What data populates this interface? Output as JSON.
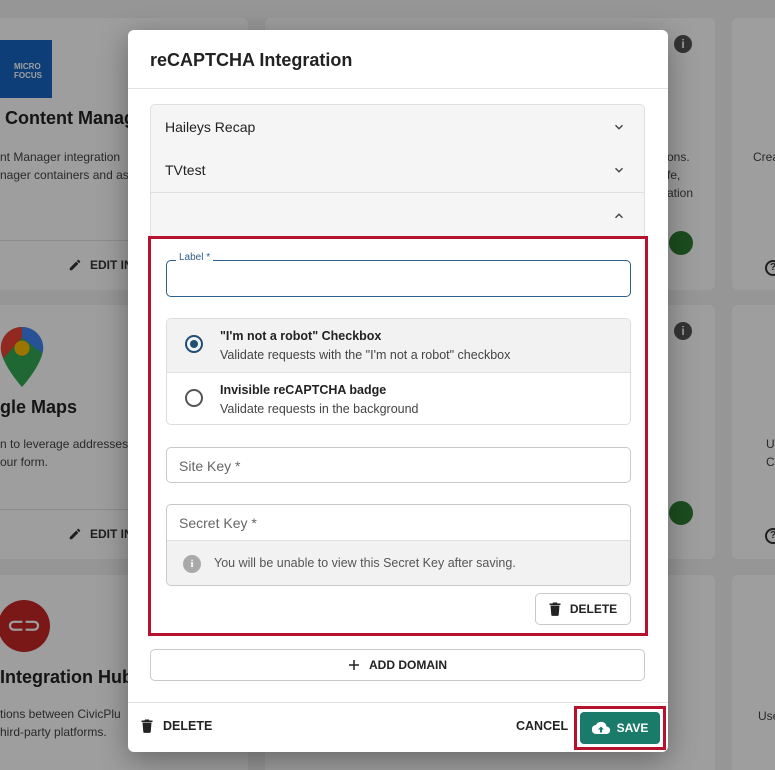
{
  "background": {
    "cards": [
      {
        "title": "Content Manag",
        "lines": [
          "nt Manager integration",
          "nager containers and as"
        ],
        "edit_label": "EDIT IN"
      },
      {
        "title": "gle Maps",
        "lines": [
          "n to leverage addresses",
          "our form."
        ],
        "edit_label": "EDIT IN"
      },
      {
        "title": "Integration Hub",
        "lines": [
          "tions between CivicPlu",
          "hird-party platforms."
        ]
      }
    ],
    "middle_right_lines": [
      "ons.",
      "fe,",
      "ation"
    ],
    "far_right_texts": [
      "Crea",
      "U",
      "C",
      "Use"
    ],
    "logo_text": [
      "MICRO",
      "FOCUS"
    ]
  },
  "modal": {
    "title": "reCAPTCHA Integration",
    "accordion": [
      {
        "label": "Haileys Recap",
        "expanded": false
      },
      {
        "label": "TVtest",
        "expanded": false
      },
      {
        "label": "",
        "expanded": true
      }
    ],
    "form": {
      "label_field": {
        "label": "Label *",
        "value": ""
      },
      "radio_options": [
        {
          "title": "\"I'm not a robot\" Checkbox",
          "description": "Validate requests with the \"I'm not a robot\" checkbox",
          "selected": true
        },
        {
          "title": "Invisible reCAPTCHA badge",
          "description": "Validate requests in the background",
          "selected": false
        }
      ],
      "site_key_placeholder": "Site Key *",
      "secret_key_placeholder": "Secret Key *",
      "secret_key_hint": "You will be unable to view this Secret Key after saving.",
      "delete_label": "DELETE"
    },
    "add_domain_label": "ADD DOMAIN",
    "footer": {
      "delete_label": "DELETE",
      "cancel_label": "CANCEL",
      "save_label": "SAVE"
    }
  },
  "colors": {
    "highlight": "#b4122d",
    "save_button": "#1b7b6b",
    "radio_selected": "#1f4f76",
    "field_focus": "#2d5f8a"
  }
}
